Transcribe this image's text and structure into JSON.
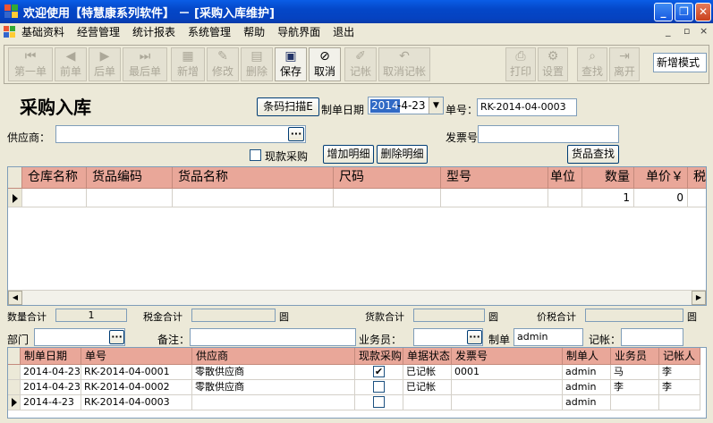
{
  "window": {
    "title": "欢迎使用【特慧康系列软件】 － [采购入库维护]",
    "controls": [
      "_",
      "❐",
      "✕"
    ]
  },
  "menubar": {
    "items": [
      "基础资料",
      "经营管理",
      "统计报表",
      "系统管理",
      "帮助",
      "导航界面",
      "退出"
    ],
    "mdi_controls": [
      "_",
      "▫",
      "×"
    ]
  },
  "toolbar": {
    "buttons": [
      {
        "label": "第一单",
        "icon": "first-icon",
        "enabled": false
      },
      {
        "label": "前单",
        "icon": "prev-icon",
        "enabled": false
      },
      {
        "label": "后单",
        "icon": "next-icon",
        "enabled": false
      },
      {
        "label": "最后单",
        "icon": "last-icon",
        "enabled": false
      },
      {
        "label": "新增",
        "icon": "new-icon",
        "enabled": false
      },
      {
        "label": "修改",
        "icon": "edit-icon",
        "enabled": false
      },
      {
        "label": "删除",
        "icon": "delete-icon",
        "enabled": false
      },
      {
        "label": "保存",
        "icon": "save-icon",
        "enabled": true
      },
      {
        "label": "取消",
        "icon": "cancel-icon",
        "enabled": true
      },
      {
        "label": "记帐",
        "icon": "post-icon",
        "enabled": false
      },
      {
        "label": "取消记帐",
        "icon": "unpost-icon",
        "enabled": false
      },
      {
        "label": "打印",
        "icon": "print-icon",
        "enabled": false
      },
      {
        "label": "设置",
        "icon": "settings-icon",
        "enabled": false
      },
      {
        "label": "查找",
        "icon": "find-icon",
        "enabled": false
      },
      {
        "label": "离开",
        "icon": "exit-icon",
        "enabled": false
      }
    ],
    "mode": "新增模式"
  },
  "form": {
    "title": "采购入库",
    "scan_button": "条码扫描E",
    "date_label": "制单日期",
    "date_selected": "2014",
    "date_rest": "-4-23",
    "doc_no_label": "单号：",
    "doc_no": "RK-2014-04-0003",
    "supplier_label": "供应商：",
    "supplier_value": "",
    "invoice_label": "发票号",
    "invoice_value": "",
    "cash_purchase_label": "现款采购",
    "add_detail": "增加明细",
    "remove_detail": "删除明细",
    "goods_find": "货品查找"
  },
  "detail_grid": {
    "columns": [
      "仓库名称",
      "货品编码",
      "货品名称",
      "尺码",
      "型号",
      "单位",
      "数量",
      "单价￥",
      "税"
    ],
    "rows": [
      [
        "",
        "",
        "",
        "",
        "",
        "",
        "1",
        "0",
        ""
      ]
    ]
  },
  "totals": {
    "qty_label": "数量合计",
    "qty_value": "1",
    "tax_label": "税金合计",
    "tax_unit": "圆",
    "goods_label": "货款合计",
    "goods_unit": "圆",
    "total_label": "价税合计",
    "total_unit": "圆"
  },
  "filters": {
    "dept_label": "部门",
    "note_label": "备注：",
    "salesman_label": "业务员：",
    "maker_label": "制单",
    "maker_value": "admin",
    "poster_label": "记帐："
  },
  "list_grid": {
    "columns": [
      "制单日期",
      "单号",
      "供应商",
      "现款采购",
      "单据状态",
      "发票号",
      "制单人",
      "业务员",
      "记帐人"
    ],
    "rows": [
      {
        "date": "2014-04-23",
        "no": "RK-2014-04-0001",
        "supplier": "零散供应商",
        "cash": true,
        "status": "已记帐",
        "invoice": "0001",
        "maker": "admin",
        "salesman": "马",
        "poster": "李",
        "current": false
      },
      {
        "date": "2014-04-23",
        "no": "RK-2014-04-0002",
        "supplier": "零散供应商",
        "cash": false,
        "status": "已记帐",
        "invoice": "",
        "maker": "admin",
        "salesman": "李",
        "poster": "李",
        "current": false
      },
      {
        "date": "2014-4-23",
        "no": "RK-2014-04-0003",
        "supplier": "",
        "cash": false,
        "status": "",
        "invoice": "",
        "maker": "admin",
        "salesman": "",
        "poster": "",
        "current": true
      }
    ]
  },
  "colors": {
    "titlebar": "#0447c8",
    "grid_header": "#e9a799",
    "window_bg": "#ece9d8"
  }
}
